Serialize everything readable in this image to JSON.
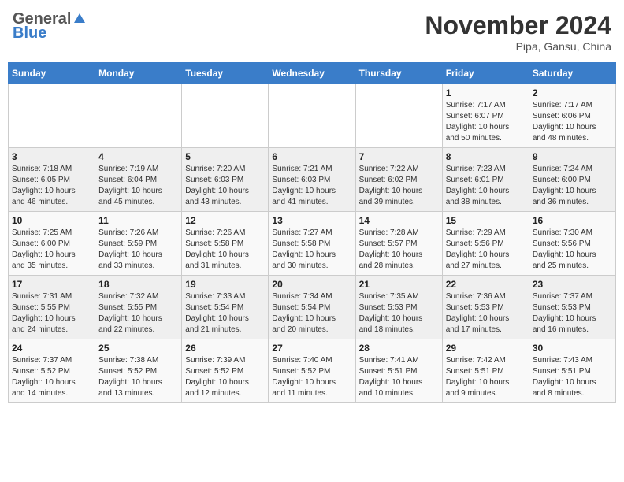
{
  "header": {
    "logo_general": "General",
    "logo_blue": "Blue",
    "month_title": "November 2024",
    "location": "Pipa, Gansu, China"
  },
  "weekdays": [
    "Sunday",
    "Monday",
    "Tuesday",
    "Wednesday",
    "Thursday",
    "Friday",
    "Saturday"
  ],
  "weeks": [
    [
      {
        "day": "",
        "info": ""
      },
      {
        "day": "",
        "info": ""
      },
      {
        "day": "",
        "info": ""
      },
      {
        "day": "",
        "info": ""
      },
      {
        "day": "",
        "info": ""
      },
      {
        "day": "1",
        "info": "Sunrise: 7:17 AM\nSunset: 6:07 PM\nDaylight: 10 hours\nand 50 minutes."
      },
      {
        "day": "2",
        "info": "Sunrise: 7:17 AM\nSunset: 6:06 PM\nDaylight: 10 hours\nand 48 minutes."
      }
    ],
    [
      {
        "day": "3",
        "info": "Sunrise: 7:18 AM\nSunset: 6:05 PM\nDaylight: 10 hours\nand 46 minutes."
      },
      {
        "day": "4",
        "info": "Sunrise: 7:19 AM\nSunset: 6:04 PM\nDaylight: 10 hours\nand 45 minutes."
      },
      {
        "day": "5",
        "info": "Sunrise: 7:20 AM\nSunset: 6:03 PM\nDaylight: 10 hours\nand 43 minutes."
      },
      {
        "day": "6",
        "info": "Sunrise: 7:21 AM\nSunset: 6:03 PM\nDaylight: 10 hours\nand 41 minutes."
      },
      {
        "day": "7",
        "info": "Sunrise: 7:22 AM\nSunset: 6:02 PM\nDaylight: 10 hours\nand 39 minutes."
      },
      {
        "day": "8",
        "info": "Sunrise: 7:23 AM\nSunset: 6:01 PM\nDaylight: 10 hours\nand 38 minutes."
      },
      {
        "day": "9",
        "info": "Sunrise: 7:24 AM\nSunset: 6:00 PM\nDaylight: 10 hours\nand 36 minutes."
      }
    ],
    [
      {
        "day": "10",
        "info": "Sunrise: 7:25 AM\nSunset: 6:00 PM\nDaylight: 10 hours\nand 35 minutes."
      },
      {
        "day": "11",
        "info": "Sunrise: 7:26 AM\nSunset: 5:59 PM\nDaylight: 10 hours\nand 33 minutes."
      },
      {
        "day": "12",
        "info": "Sunrise: 7:26 AM\nSunset: 5:58 PM\nDaylight: 10 hours\nand 31 minutes."
      },
      {
        "day": "13",
        "info": "Sunrise: 7:27 AM\nSunset: 5:58 PM\nDaylight: 10 hours\nand 30 minutes."
      },
      {
        "day": "14",
        "info": "Sunrise: 7:28 AM\nSunset: 5:57 PM\nDaylight: 10 hours\nand 28 minutes."
      },
      {
        "day": "15",
        "info": "Sunrise: 7:29 AM\nSunset: 5:56 PM\nDaylight: 10 hours\nand 27 minutes."
      },
      {
        "day": "16",
        "info": "Sunrise: 7:30 AM\nSunset: 5:56 PM\nDaylight: 10 hours\nand 25 minutes."
      }
    ],
    [
      {
        "day": "17",
        "info": "Sunrise: 7:31 AM\nSunset: 5:55 PM\nDaylight: 10 hours\nand 24 minutes."
      },
      {
        "day": "18",
        "info": "Sunrise: 7:32 AM\nSunset: 5:55 PM\nDaylight: 10 hours\nand 22 minutes."
      },
      {
        "day": "19",
        "info": "Sunrise: 7:33 AM\nSunset: 5:54 PM\nDaylight: 10 hours\nand 21 minutes."
      },
      {
        "day": "20",
        "info": "Sunrise: 7:34 AM\nSunset: 5:54 PM\nDaylight: 10 hours\nand 20 minutes."
      },
      {
        "day": "21",
        "info": "Sunrise: 7:35 AM\nSunset: 5:53 PM\nDaylight: 10 hours\nand 18 minutes."
      },
      {
        "day": "22",
        "info": "Sunrise: 7:36 AM\nSunset: 5:53 PM\nDaylight: 10 hours\nand 17 minutes."
      },
      {
        "day": "23",
        "info": "Sunrise: 7:37 AM\nSunset: 5:53 PM\nDaylight: 10 hours\nand 16 minutes."
      }
    ],
    [
      {
        "day": "24",
        "info": "Sunrise: 7:37 AM\nSunset: 5:52 PM\nDaylight: 10 hours\nand 14 minutes."
      },
      {
        "day": "25",
        "info": "Sunrise: 7:38 AM\nSunset: 5:52 PM\nDaylight: 10 hours\nand 13 minutes."
      },
      {
        "day": "26",
        "info": "Sunrise: 7:39 AM\nSunset: 5:52 PM\nDaylight: 10 hours\nand 12 minutes."
      },
      {
        "day": "27",
        "info": "Sunrise: 7:40 AM\nSunset: 5:52 PM\nDaylight: 10 hours\nand 11 minutes."
      },
      {
        "day": "28",
        "info": "Sunrise: 7:41 AM\nSunset: 5:51 PM\nDaylight: 10 hours\nand 10 minutes."
      },
      {
        "day": "29",
        "info": "Sunrise: 7:42 AM\nSunset: 5:51 PM\nDaylight: 10 hours\nand 9 minutes."
      },
      {
        "day": "30",
        "info": "Sunrise: 7:43 AM\nSunset: 5:51 PM\nDaylight: 10 hours\nand 8 minutes."
      }
    ]
  ]
}
